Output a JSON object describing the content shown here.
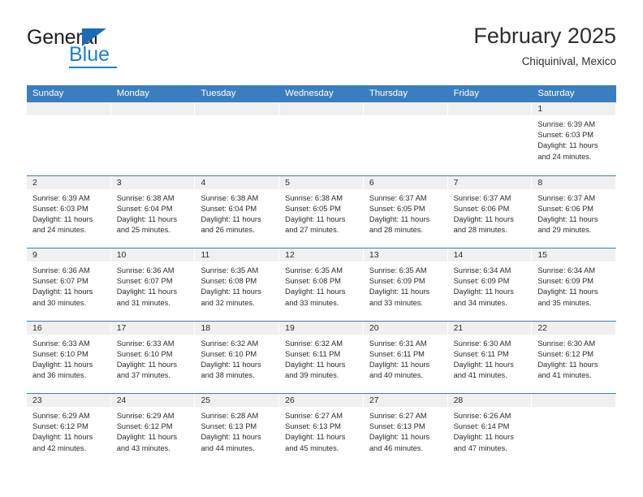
{
  "brand": {
    "name_part1": "General",
    "name_part2": "Blue",
    "triangle_color": "#1b6cb5",
    "blue_color": "#1b7fd4"
  },
  "header": {
    "title": "February 2025",
    "subtitle": "Chiquinival, Mexico"
  },
  "theme": {
    "header_blue": "#3a7ebf",
    "daynum_band": "#f0f0f0",
    "text": "#2b2b2b"
  },
  "weekdays": [
    "Sunday",
    "Monday",
    "Tuesday",
    "Wednesday",
    "Thursday",
    "Friday",
    "Saturday"
  ],
  "weeks": [
    [
      {
        "empty": true
      },
      {
        "empty": true
      },
      {
        "empty": true
      },
      {
        "empty": true
      },
      {
        "empty": true
      },
      {
        "empty": true
      },
      {
        "day": "1",
        "sunrise": "Sunrise: 6:39 AM",
        "sunset": "Sunset: 6:03 PM",
        "daylight_l1": "Daylight: 11 hours",
        "daylight_l2": "and 24 minutes."
      }
    ],
    [
      {
        "day": "2",
        "sunrise": "Sunrise: 6:39 AM",
        "sunset": "Sunset: 6:03 PM",
        "daylight_l1": "Daylight: 11 hours",
        "daylight_l2": "and 24 minutes."
      },
      {
        "day": "3",
        "sunrise": "Sunrise: 6:38 AM",
        "sunset": "Sunset: 6:04 PM",
        "daylight_l1": "Daylight: 11 hours",
        "daylight_l2": "and 25 minutes."
      },
      {
        "day": "4",
        "sunrise": "Sunrise: 6:38 AM",
        "sunset": "Sunset: 6:04 PM",
        "daylight_l1": "Daylight: 11 hours",
        "daylight_l2": "and 26 minutes."
      },
      {
        "day": "5",
        "sunrise": "Sunrise: 6:38 AM",
        "sunset": "Sunset: 6:05 PM",
        "daylight_l1": "Daylight: 11 hours",
        "daylight_l2": "and 27 minutes."
      },
      {
        "day": "6",
        "sunrise": "Sunrise: 6:37 AM",
        "sunset": "Sunset: 6:05 PM",
        "daylight_l1": "Daylight: 11 hours",
        "daylight_l2": "and 28 minutes."
      },
      {
        "day": "7",
        "sunrise": "Sunrise: 6:37 AM",
        "sunset": "Sunset: 6:06 PM",
        "daylight_l1": "Daylight: 11 hours",
        "daylight_l2": "and 28 minutes."
      },
      {
        "day": "8",
        "sunrise": "Sunrise: 6:37 AM",
        "sunset": "Sunset: 6:06 PM",
        "daylight_l1": "Daylight: 11 hours",
        "daylight_l2": "and 29 minutes."
      }
    ],
    [
      {
        "day": "9",
        "sunrise": "Sunrise: 6:36 AM",
        "sunset": "Sunset: 6:07 PM",
        "daylight_l1": "Daylight: 11 hours",
        "daylight_l2": "and 30 minutes."
      },
      {
        "day": "10",
        "sunrise": "Sunrise: 6:36 AM",
        "sunset": "Sunset: 6:07 PM",
        "daylight_l1": "Daylight: 11 hours",
        "daylight_l2": "and 31 minutes."
      },
      {
        "day": "11",
        "sunrise": "Sunrise: 6:35 AM",
        "sunset": "Sunset: 6:08 PM",
        "daylight_l1": "Daylight: 11 hours",
        "daylight_l2": "and 32 minutes."
      },
      {
        "day": "12",
        "sunrise": "Sunrise: 6:35 AM",
        "sunset": "Sunset: 6:08 PM",
        "daylight_l1": "Daylight: 11 hours",
        "daylight_l2": "and 33 minutes."
      },
      {
        "day": "13",
        "sunrise": "Sunrise: 6:35 AM",
        "sunset": "Sunset: 6:09 PM",
        "daylight_l1": "Daylight: 11 hours",
        "daylight_l2": "and 33 minutes."
      },
      {
        "day": "14",
        "sunrise": "Sunrise: 6:34 AM",
        "sunset": "Sunset: 6:09 PM",
        "daylight_l1": "Daylight: 11 hours",
        "daylight_l2": "and 34 minutes."
      },
      {
        "day": "15",
        "sunrise": "Sunrise: 6:34 AM",
        "sunset": "Sunset: 6:09 PM",
        "daylight_l1": "Daylight: 11 hours",
        "daylight_l2": "and 35 minutes."
      }
    ],
    [
      {
        "day": "16",
        "sunrise": "Sunrise: 6:33 AM",
        "sunset": "Sunset: 6:10 PM",
        "daylight_l1": "Daylight: 11 hours",
        "daylight_l2": "and 36 minutes."
      },
      {
        "day": "17",
        "sunrise": "Sunrise: 6:33 AM",
        "sunset": "Sunset: 6:10 PM",
        "daylight_l1": "Daylight: 11 hours",
        "daylight_l2": "and 37 minutes."
      },
      {
        "day": "18",
        "sunrise": "Sunrise: 6:32 AM",
        "sunset": "Sunset: 6:10 PM",
        "daylight_l1": "Daylight: 11 hours",
        "daylight_l2": "and 38 minutes."
      },
      {
        "day": "19",
        "sunrise": "Sunrise: 6:32 AM",
        "sunset": "Sunset: 6:11 PM",
        "daylight_l1": "Daylight: 11 hours",
        "daylight_l2": "and 39 minutes."
      },
      {
        "day": "20",
        "sunrise": "Sunrise: 6:31 AM",
        "sunset": "Sunset: 6:11 PM",
        "daylight_l1": "Daylight: 11 hours",
        "daylight_l2": "and 40 minutes."
      },
      {
        "day": "21",
        "sunrise": "Sunrise: 6:30 AM",
        "sunset": "Sunset: 6:11 PM",
        "daylight_l1": "Daylight: 11 hours",
        "daylight_l2": "and 41 minutes."
      },
      {
        "day": "22",
        "sunrise": "Sunrise: 6:30 AM",
        "sunset": "Sunset: 6:12 PM",
        "daylight_l1": "Daylight: 11 hours",
        "daylight_l2": "and 41 minutes."
      }
    ],
    [
      {
        "day": "23",
        "sunrise": "Sunrise: 6:29 AM",
        "sunset": "Sunset: 6:12 PM",
        "daylight_l1": "Daylight: 11 hours",
        "daylight_l2": "and 42 minutes."
      },
      {
        "day": "24",
        "sunrise": "Sunrise: 6:29 AM",
        "sunset": "Sunset: 6:12 PM",
        "daylight_l1": "Daylight: 11 hours",
        "daylight_l2": "and 43 minutes."
      },
      {
        "day": "25",
        "sunrise": "Sunrise: 6:28 AM",
        "sunset": "Sunset: 6:13 PM",
        "daylight_l1": "Daylight: 11 hours",
        "daylight_l2": "and 44 minutes."
      },
      {
        "day": "26",
        "sunrise": "Sunrise: 6:27 AM",
        "sunset": "Sunset: 6:13 PM",
        "daylight_l1": "Daylight: 11 hours",
        "daylight_l2": "and 45 minutes."
      },
      {
        "day": "27",
        "sunrise": "Sunrise: 6:27 AM",
        "sunset": "Sunset: 6:13 PM",
        "daylight_l1": "Daylight: 11 hours",
        "daylight_l2": "and 46 minutes."
      },
      {
        "day": "28",
        "sunrise": "Sunrise: 6:26 AM",
        "sunset": "Sunset: 6:14 PM",
        "daylight_l1": "Daylight: 11 hours",
        "daylight_l2": "and 47 minutes."
      },
      {
        "empty": true
      }
    ]
  ]
}
